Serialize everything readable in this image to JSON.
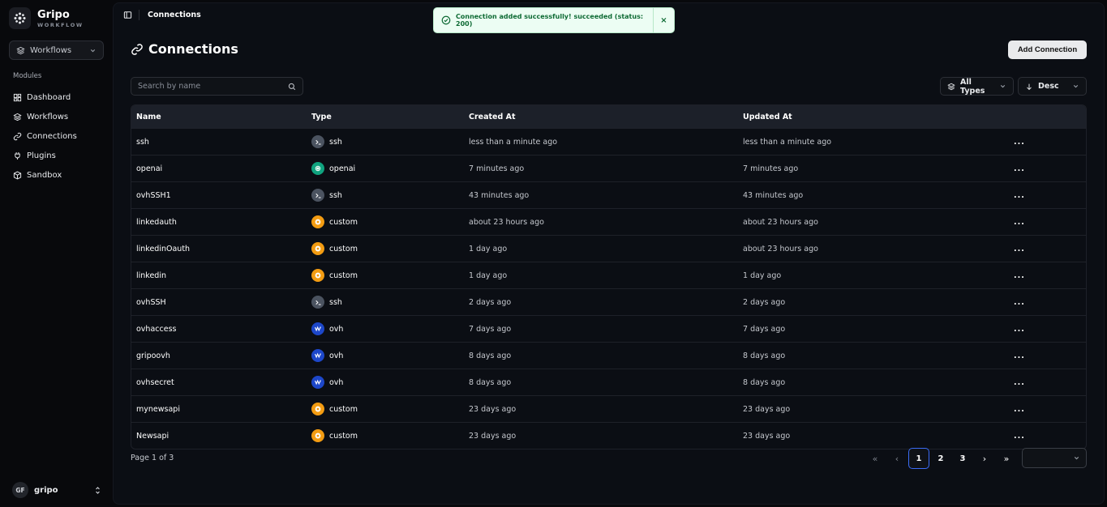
{
  "brand": {
    "name": "Gripo",
    "subtitle": "WORKFLOW"
  },
  "workspace_select": {
    "value": "Workflows"
  },
  "sidebar": {
    "section_label": "Modules",
    "items": [
      {
        "label": "Dashboard",
        "icon": "dashboard-icon"
      },
      {
        "label": "Workflows",
        "icon": "layers-icon"
      },
      {
        "label": "Connections",
        "icon": "link-icon"
      },
      {
        "label": "Plugins",
        "icon": "plug-icon"
      },
      {
        "label": "Sandbox",
        "icon": "box-icon"
      }
    ]
  },
  "user": {
    "initials": "GF",
    "name": "gripo"
  },
  "breadcrumb": {
    "current": "Connections"
  },
  "page": {
    "title": "Connections",
    "add_label": "Add Connection"
  },
  "search": {
    "placeholder": "Search by name",
    "value": ""
  },
  "filters": {
    "type_label": "All Types",
    "sort_label": "Desc"
  },
  "table": {
    "columns": [
      "Name",
      "Type",
      "Created At",
      "Updated At"
    ],
    "rows": [
      {
        "name": "ssh",
        "type": "ssh",
        "created": "less than a minute ago",
        "updated": "less than a minute ago"
      },
      {
        "name": "openai",
        "type": "openai",
        "created": "7 minutes ago",
        "updated": "7 minutes ago"
      },
      {
        "name": "ovhSSH1",
        "type": "ssh",
        "created": "43 minutes ago",
        "updated": "43 minutes ago"
      },
      {
        "name": "linkedauth",
        "type": "custom",
        "created": "about 23 hours ago",
        "updated": "about 23 hours ago"
      },
      {
        "name": "linkedinOauth",
        "type": "custom",
        "created": "1 day ago",
        "updated": "about 23 hours ago"
      },
      {
        "name": "linkedin",
        "type": "custom",
        "created": "1 day ago",
        "updated": "1 day ago"
      },
      {
        "name": "ovhSSH",
        "type": "ssh",
        "created": "2 days ago",
        "updated": "2 days ago"
      },
      {
        "name": "ovhaccess",
        "type": "ovh",
        "created": "7 days ago",
        "updated": "7 days ago"
      },
      {
        "name": "gripoovh",
        "type": "ovh",
        "created": "8 days ago",
        "updated": "8 days ago"
      },
      {
        "name": "ovhsecret",
        "type": "ovh",
        "created": "8 days ago",
        "updated": "8 days ago"
      },
      {
        "name": "mynewsapi",
        "type": "custom",
        "created": "23 days ago",
        "updated": "23 days ago"
      },
      {
        "name": "Newsapi",
        "type": "custom",
        "created": "23 days ago",
        "updated": "23 days ago"
      }
    ],
    "row_action": "..."
  },
  "pagination": {
    "info": "Page 1 of 3",
    "pages": [
      "1",
      "2",
      "3"
    ],
    "current": "1"
  },
  "toast": {
    "message": "Connection added successfully! succeeded (status: 200)",
    "close": "×"
  },
  "colors": {
    "ssh": "#4b5360",
    "openai": "#10a37f",
    "custom": "#f39c12",
    "ovh": "#1d47c9",
    "accent": "#3b6cf5"
  }
}
